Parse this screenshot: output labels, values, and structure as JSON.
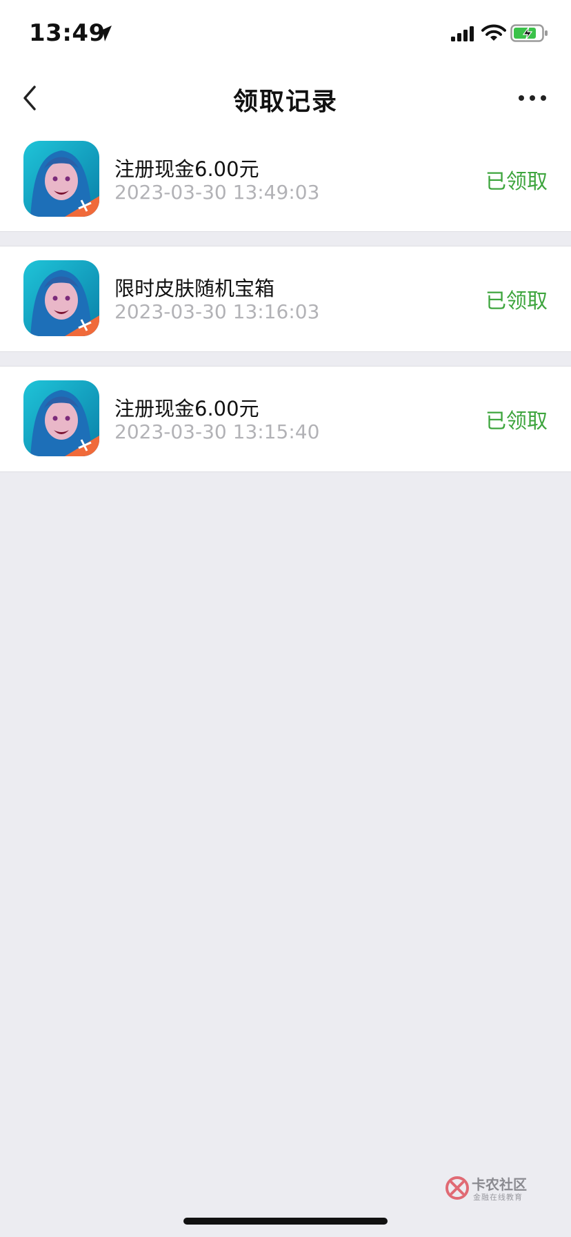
{
  "status_bar": {
    "time": "13:49",
    "icons": [
      "location-arrow-icon",
      "cellular-signal-icon",
      "wifi-icon",
      "battery-charging-icon"
    ],
    "battery_color": "#3bc24a"
  },
  "nav": {
    "title": "领取记录",
    "back_icon": "chevron-left-icon",
    "more_icon": "ellipsis-icon"
  },
  "records": [
    {
      "name": "注册现金6.00元",
      "time": "2023-03-30 13:49:03",
      "status": "已领取"
    },
    {
      "name": "限时皮肤随机宝箱",
      "time": "2023-03-30 13:16:03",
      "status": "已领取"
    },
    {
      "name": "注册现金6.00元",
      "time": "2023-03-30 13:15:40",
      "status": "已领取"
    }
  ],
  "colors": {
    "status_green": "#3ea53e",
    "time_gray": "#b2b2b6",
    "background": "#ececf1"
  },
  "watermark": {
    "title": "卡农社区",
    "subtitle": "金融在线教育"
  }
}
